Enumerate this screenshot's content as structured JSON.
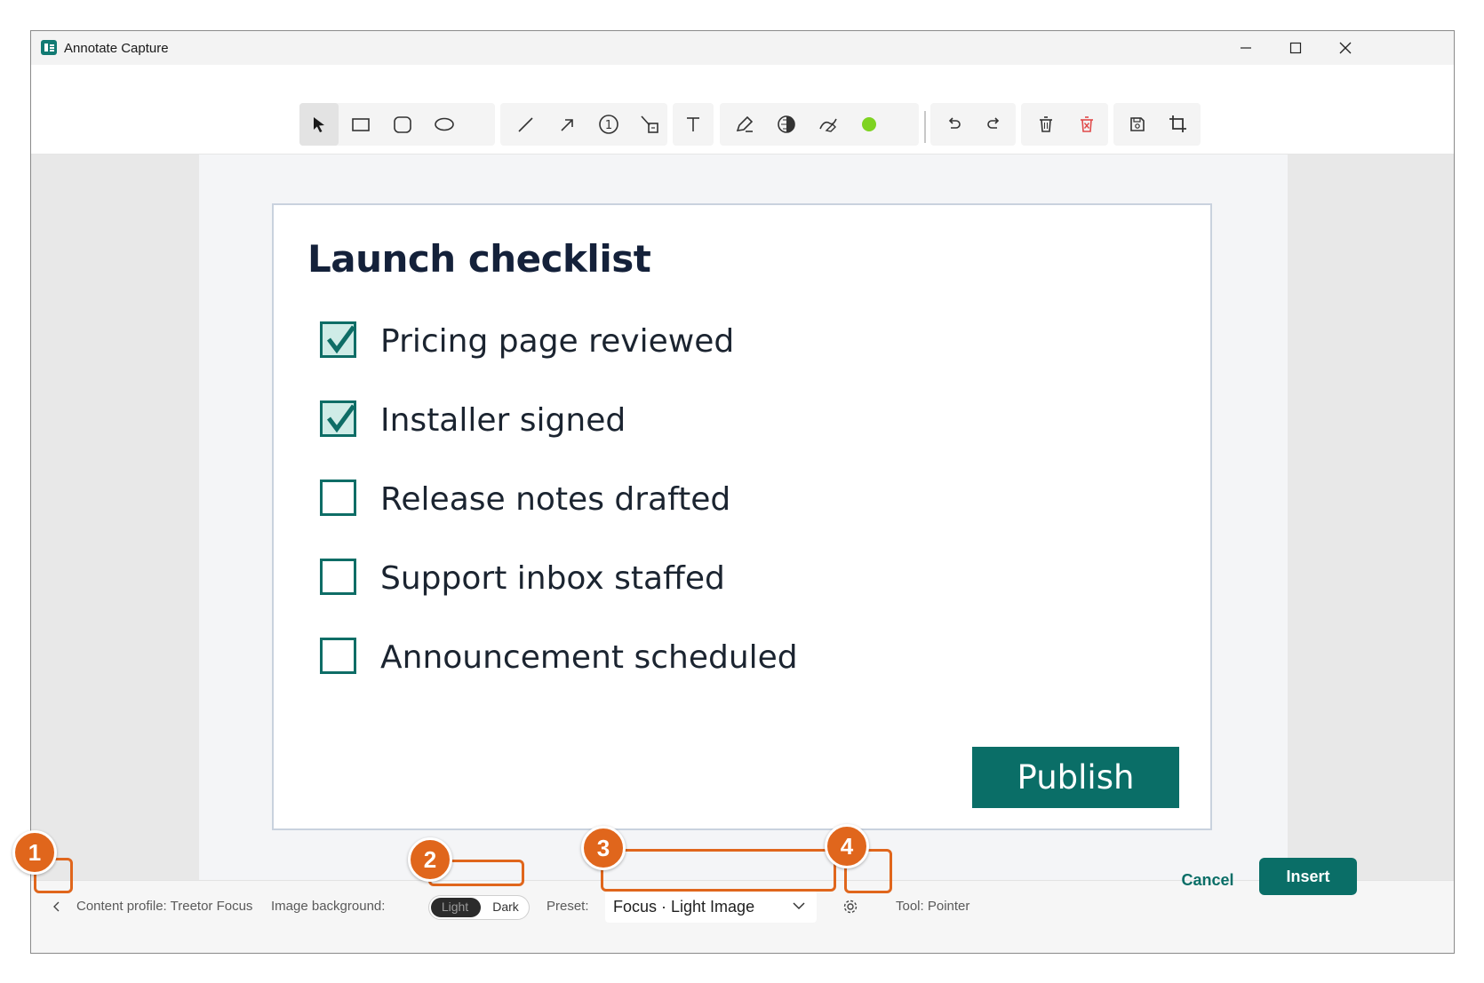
{
  "window": {
    "title": "Annotate Capture",
    "controls": [
      "minimize-icon",
      "maximize-icon",
      "close-icon"
    ]
  },
  "toolbar": {
    "tools": [
      {
        "name": "pointer",
        "icon": "pointer-icon",
        "active": true
      },
      {
        "name": "rectangle",
        "icon": "rectangle-icon"
      },
      {
        "name": "rounded-rectangle",
        "icon": "rounded-rectangle-icon"
      },
      {
        "name": "ellipse",
        "icon": "ellipse-icon"
      },
      {
        "name": "line",
        "icon": "line-icon"
      },
      {
        "name": "arrow",
        "icon": "arrow-icon"
      },
      {
        "name": "step-number",
        "icon": "step-number-icon",
        "glyph": "1"
      },
      {
        "name": "callout",
        "icon": "callout-icon"
      },
      {
        "name": "text",
        "icon": "text-icon",
        "glyph": "T"
      },
      {
        "name": "highlighter",
        "icon": "highlighter-icon"
      },
      {
        "name": "blur",
        "icon": "blur-icon"
      },
      {
        "name": "eraser",
        "icon": "eraser-icon"
      },
      {
        "name": "color",
        "icon": "color-swatch-icon",
        "color": "#7ed321"
      },
      {
        "name": "undo",
        "icon": "undo-icon"
      },
      {
        "name": "redo",
        "icon": "redo-icon"
      },
      {
        "name": "delete",
        "icon": "delete-icon"
      },
      {
        "name": "delete-all",
        "icon": "delete-all-icon",
        "color": "#e04a4a"
      },
      {
        "name": "save",
        "icon": "save-icon"
      },
      {
        "name": "crop",
        "icon": "crop-icon"
      }
    ]
  },
  "capture": {
    "title": "Launch checklist",
    "items": [
      {
        "label": "Pricing page reviewed",
        "checked": true
      },
      {
        "label": "Installer signed",
        "checked": true
      },
      {
        "label": "Release notes drafted",
        "checked": false
      },
      {
        "label": "Support inbox staffed",
        "checked": false
      },
      {
        "label": "Announcement scheduled",
        "checked": false
      }
    ],
    "publish_label": "Publish",
    "accent": "#0a6e67"
  },
  "statusbar": {
    "content_profile": "Content profile: Treetor Focus",
    "image_background_label": "Image background:",
    "toggle_light": "Light",
    "toggle_dark": "Dark",
    "preset_label": "Preset:",
    "preset_value": "Focus · Light Image",
    "tool_status": "Tool: Pointer"
  },
  "actions": {
    "cancel_label": "Cancel",
    "insert_label": "Insert"
  },
  "callouts": [
    "1",
    "2",
    "3",
    "4"
  ],
  "colors": {
    "callout": "#e0661c",
    "accent": "#0a6e67"
  }
}
